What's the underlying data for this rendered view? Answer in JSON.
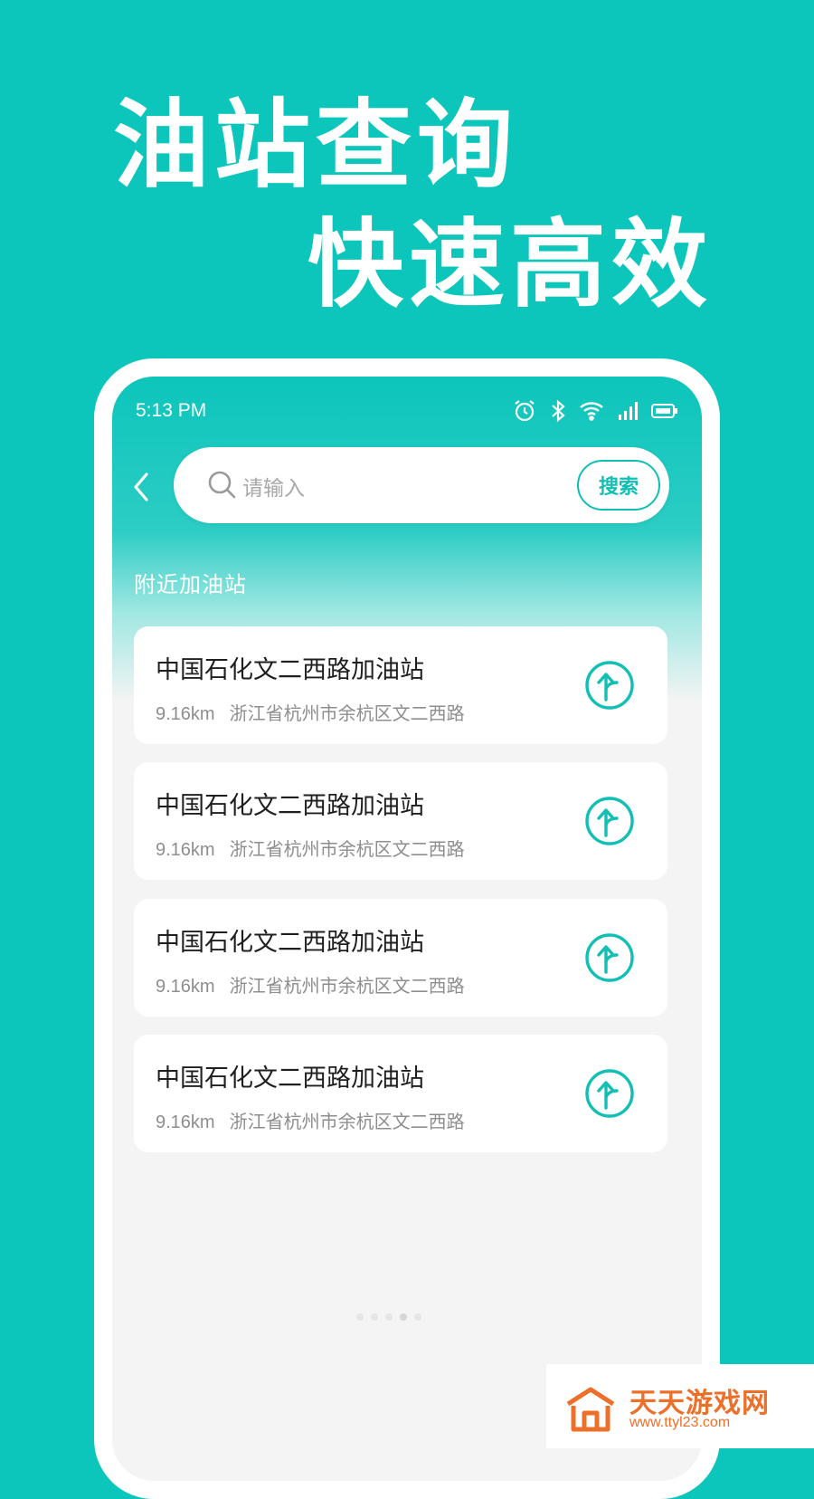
{
  "headline": {
    "line1": "油站查询",
    "line2": "快速高效"
  },
  "status_bar": {
    "time": "5:13 PM"
  },
  "search": {
    "placeholder": "请输入",
    "button_label": "搜索"
  },
  "section_title": "附近加油站",
  "stations": [
    {
      "name": "中国石化文二西路加油站",
      "distance": "9.16km",
      "address": "浙江省杭州市余杭区文二西路"
    },
    {
      "name": "中国石化文二西路加油站",
      "distance": "9.16km",
      "address": "浙江省杭州市余杭区文二西路"
    },
    {
      "name": "中国石化文二西路加油站",
      "distance": "9.16km",
      "address": "浙江省杭州市余杭区文二西路"
    },
    {
      "name": "中国石化文二西路加油站",
      "distance": "9.16km",
      "address": "浙江省杭州市余杭区文二西路"
    }
  ],
  "watermark": {
    "title": "天天游戏网",
    "url": "www.ttyl23.com"
  },
  "colors": {
    "brand_teal": "#0cc5bb",
    "accent": "#11bfb4",
    "watermark_orange": "#ec6f2a"
  },
  "icons": [
    "alarm-icon",
    "bluetooth-icon",
    "wifi-icon",
    "signal-icon",
    "battery-icon",
    "back-chevron-icon",
    "search-icon",
    "navigate-icon"
  ]
}
